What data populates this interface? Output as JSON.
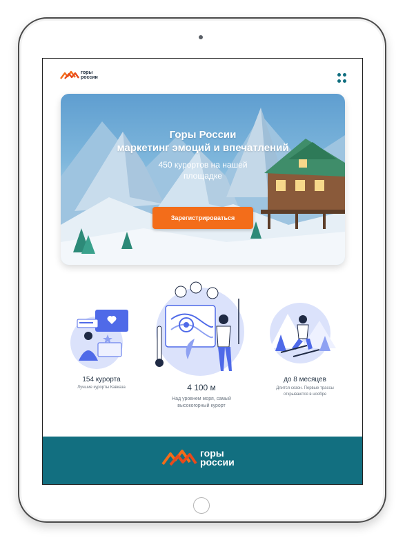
{
  "brand": {
    "logo_line1": "горы",
    "logo_line2": "россии"
  },
  "hero": {
    "title_line1": "Горы России",
    "title_line2": "маркетинг эмоций и впечатлений",
    "subtitle_line1": "450 курортов на нашей",
    "subtitle_line2": "площадке",
    "cta_label": "Зарегистрироваться"
  },
  "features": [
    {
      "value": "154 курорта",
      "desc_line1": "Лучшие курорты Кавказа",
      "desc_line2": ""
    },
    {
      "value": "4 100 м",
      "desc_line1": "Над уровнем моря, самый",
      "desc_line2": "высокогорный курорт"
    },
    {
      "value": "до 8 месяцев",
      "desc_line1": "Длится сезон. Первые трассы",
      "desc_line2": "открываются в ноябре"
    }
  ],
  "colors": {
    "accent": "#f36d1a",
    "footer": "#126f80",
    "illustration": "#4f6ae8"
  },
  "icons": [
    "menu-icon",
    "logo-mark-icon"
  ]
}
